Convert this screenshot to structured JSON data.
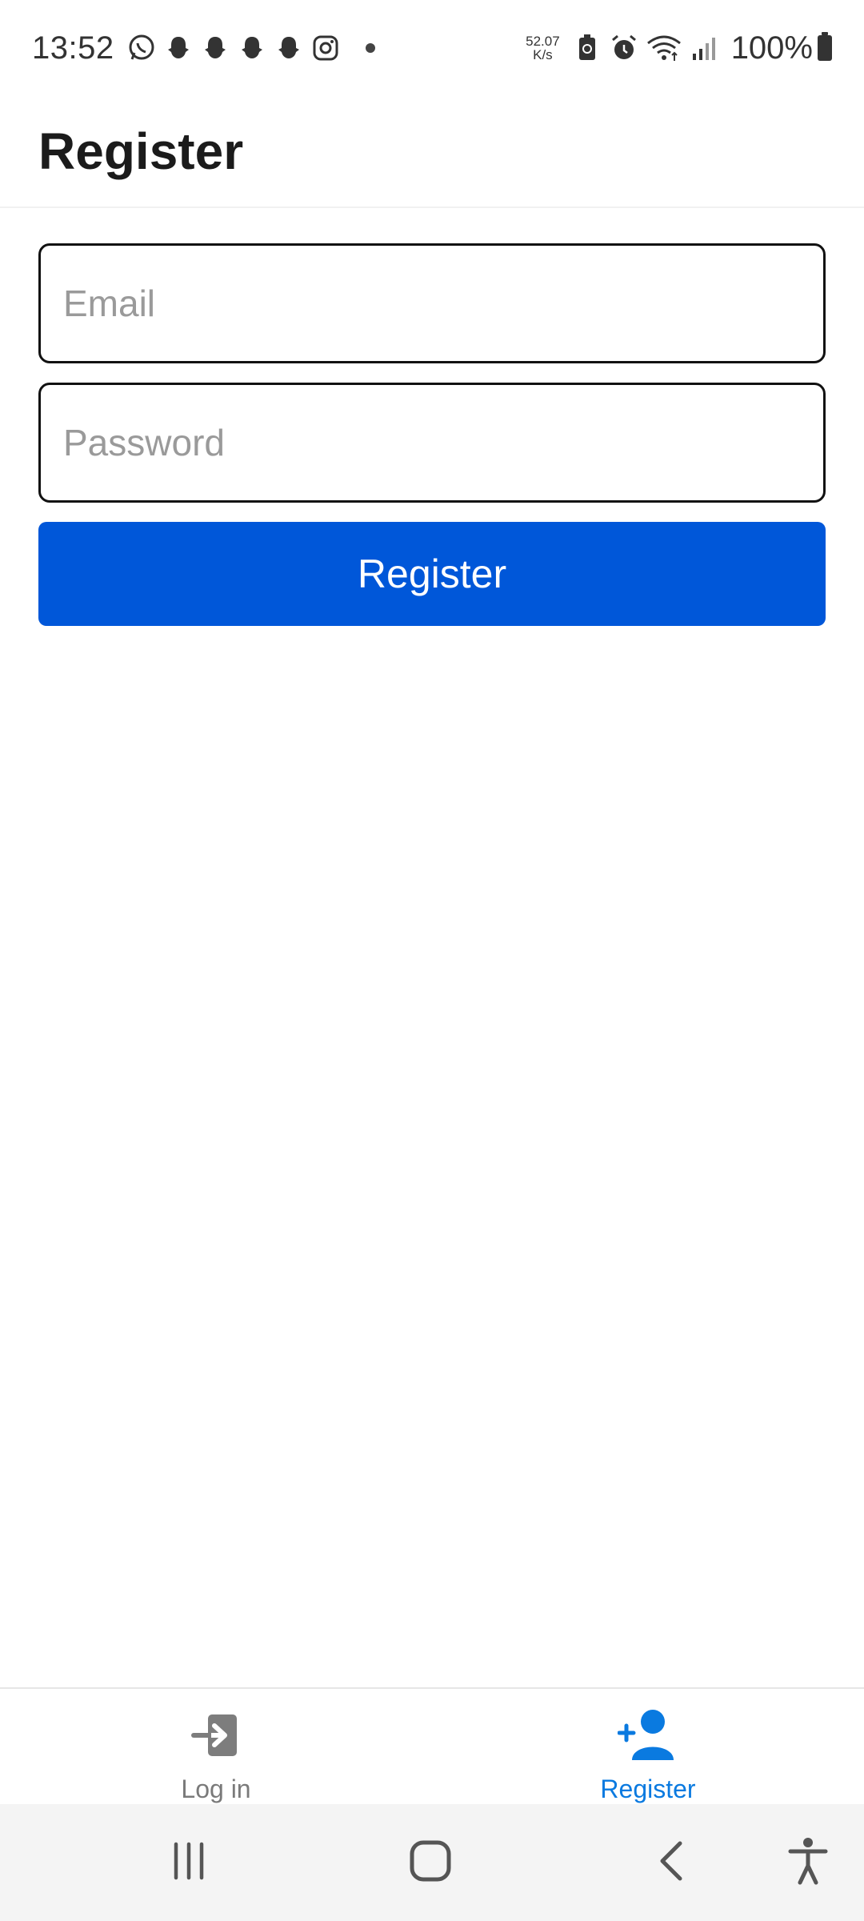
{
  "status_bar": {
    "time": "13:52",
    "net_speed_value": "52.07",
    "net_speed_unit": "K/s",
    "battery_percent": "100%",
    "notification_icons": [
      "whatsapp-icon",
      "snapchat-icon",
      "snapchat-icon",
      "snapchat-icon",
      "snapchat-icon",
      "instagram-icon"
    ]
  },
  "header": {
    "title": "Register"
  },
  "form": {
    "email_placeholder": "Email",
    "email_value": "",
    "password_placeholder": "Password",
    "password_value": "",
    "submit_label": "Register"
  },
  "tabs": [
    {
      "label": "Log in",
      "icon": "login-icon",
      "active": false
    },
    {
      "label": "Register",
      "icon": "add-user-icon",
      "active": true
    }
  ],
  "colors": {
    "primary": "#0057d9",
    "active_tab": "#0a7ae0",
    "inactive_tab": "#7a7a7a"
  }
}
